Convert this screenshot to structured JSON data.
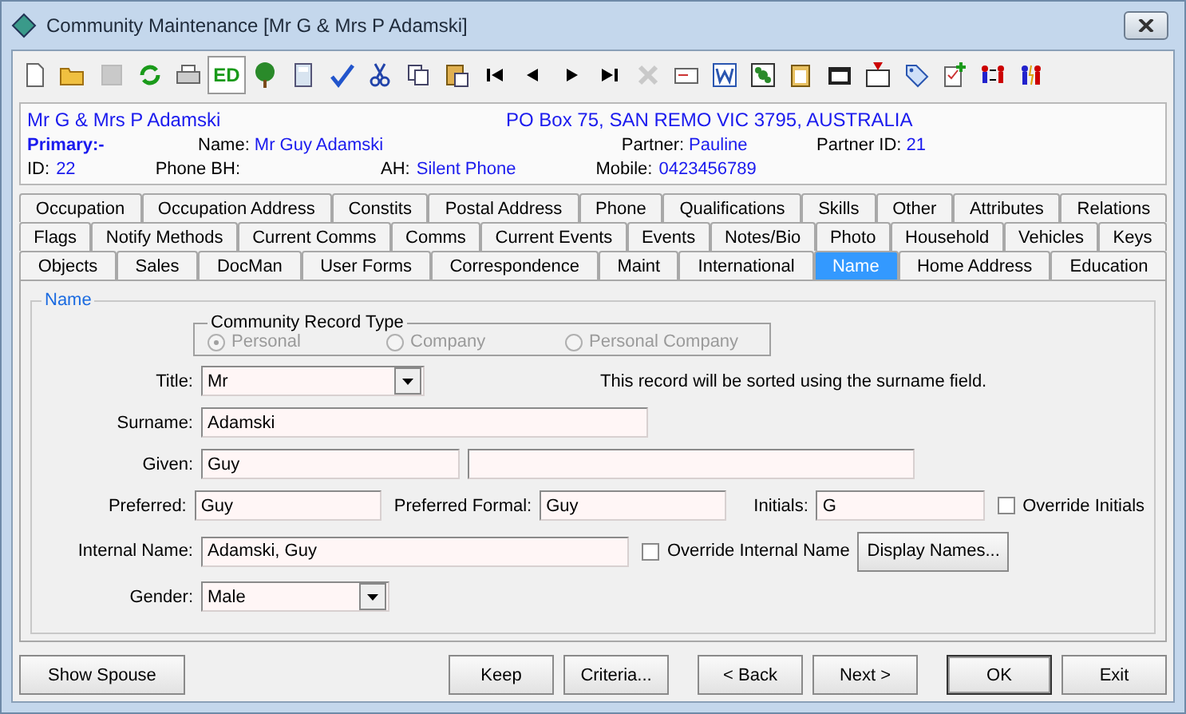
{
  "window": {
    "title": "Community Maintenance  [Mr G & Mrs P Adamski]"
  },
  "toolbar": [
    {
      "disabled": false,
      "pressed": false
    },
    {
      "disabled": false,
      "pressed": false
    },
    {
      "disabled": true,
      "pressed": false
    },
    {
      "disabled": false,
      "pressed": false
    },
    {
      "disabled": false,
      "pressed": false
    },
    {
      "disabled": false,
      "pressed": true,
      "label": "ED"
    },
    {
      "disabled": false,
      "pressed": false
    },
    {
      "disabled": false,
      "pressed": false
    },
    {
      "disabled": false,
      "pressed": false
    },
    {
      "disabled": false,
      "pressed": false
    },
    {
      "disabled": false,
      "pressed": false
    },
    {
      "disabled": false,
      "pressed": false
    },
    {
      "disabled": false,
      "pressed": false
    },
    {
      "disabled": false,
      "pressed": false
    },
    {
      "disabled": false,
      "pressed": false
    },
    {
      "disabled": false,
      "pressed": false
    },
    {
      "disabled": true,
      "pressed": false
    },
    {
      "disabled": false,
      "pressed": false
    },
    {
      "disabled": false,
      "pressed": false
    },
    {
      "disabled": false,
      "pressed": false
    },
    {
      "disabled": false,
      "pressed": false
    },
    {
      "disabled": false,
      "pressed": false
    },
    {
      "disabled": false,
      "pressed": false
    },
    {
      "disabled": false,
      "pressed": false
    },
    {
      "disabled": false,
      "pressed": false
    },
    {
      "disabled": false,
      "pressed": false
    },
    {
      "disabled": false,
      "pressed": false
    }
  ],
  "header": {
    "name": "Mr G & Mrs P Adamski",
    "address": "PO Box 75, SAN REMO VIC 3795, AUSTRALIA",
    "primary": "Primary:-",
    "row1": [
      {
        "label": "Name:",
        "value": "Mr Guy Adamski"
      },
      {
        "label": "Partner:",
        "value": "Pauline"
      },
      {
        "label": "Partner ID:",
        "value": "21"
      }
    ],
    "row2": [
      {
        "label": "ID:",
        "value": "22"
      },
      {
        "label": "Phone BH:"
      },
      {
        "label": "AH:",
        "value": "Silent Phone"
      },
      {
        "label": "Mobile:",
        "value": "0423456789"
      }
    ]
  },
  "tab_rows": [
    [
      {
        "label": "Occupation",
        "selected": false
      },
      {
        "label": "Occupation Address",
        "selected": false
      },
      {
        "label": "Constits",
        "selected": false
      },
      {
        "label": "Postal Address",
        "selected": false
      },
      {
        "label": "Phone",
        "selected": false
      },
      {
        "label": "Qualifications",
        "selected": false
      },
      {
        "label": "Skills",
        "selected": false
      },
      {
        "label": "Other",
        "selected": false
      },
      {
        "label": "Attributes",
        "selected": false
      },
      {
        "label": "Relations",
        "selected": false
      }
    ],
    [
      {
        "label": "Flags",
        "selected": false
      },
      {
        "label": "Notify Methods",
        "selected": false
      },
      {
        "label": "Current Comms",
        "selected": false
      },
      {
        "label": "Comms",
        "selected": false
      },
      {
        "label": "Current Events",
        "selected": false
      },
      {
        "label": "Events",
        "selected": false
      },
      {
        "label": "Notes/Bio",
        "selected": false
      },
      {
        "label": "Photo",
        "selected": false
      },
      {
        "label": "Household",
        "selected": false
      },
      {
        "label": "Vehicles",
        "selected": false
      },
      {
        "label": "Keys",
        "selected": false
      }
    ],
    [
      {
        "label": "Objects",
        "selected": false
      },
      {
        "label": "Sales",
        "selected": false
      },
      {
        "label": "DocMan",
        "selected": false
      },
      {
        "label": "User Forms",
        "selected": false
      },
      {
        "label": "Correspondence",
        "selected": false
      },
      {
        "label": "Maint",
        "selected": false
      },
      {
        "label": "International",
        "selected": false
      },
      {
        "label": "Name",
        "selected": true
      },
      {
        "label": "Home Address",
        "selected": false
      },
      {
        "label": "Education",
        "selected": false
      }
    ]
  ],
  "panel": {
    "legend": "Name",
    "record_type": {
      "title": "Community Record Type",
      "options": [
        {
          "label": "Personal",
          "selected": true
        },
        {
          "label": "Company",
          "selected": false
        },
        {
          "label": "Personal Company",
          "selected": false
        }
      ]
    },
    "title_label": "Title:",
    "title_value": "Mr",
    "sort_note": "This record will be sorted using the surname field.",
    "surname_label": "Surname:",
    "surname": "Adamski",
    "given_label": "Given:",
    "given": "Guy",
    "preferred_label": "Preferred:",
    "preferred": "Guy",
    "preferred_formal_label": "Preferred Formal:",
    "preferred_formal": "Guy",
    "initials_label": "Initials:",
    "initials": "G",
    "override_initials": {
      "label": "Override Initials",
      "checked": false
    },
    "internal_label": "Internal Name:",
    "internal": "Adamski, Guy",
    "override_internal": {
      "label": "Override Internal Name",
      "checked": false
    },
    "display_names": "Display Names...",
    "gender_label": "Gender:",
    "gender": "Male"
  },
  "buttons_left": [
    "Show Spouse"
  ],
  "buttons_right": [
    {
      "label": "Keep",
      "default": false
    },
    {
      "label": "Criteria...",
      "default": false
    },
    {
      "label": "< Back",
      "default": false
    },
    {
      "label": "Next >",
      "default": false
    },
    {
      "label": "OK",
      "default": true
    },
    {
      "label": "Exit",
      "default": false
    }
  ]
}
